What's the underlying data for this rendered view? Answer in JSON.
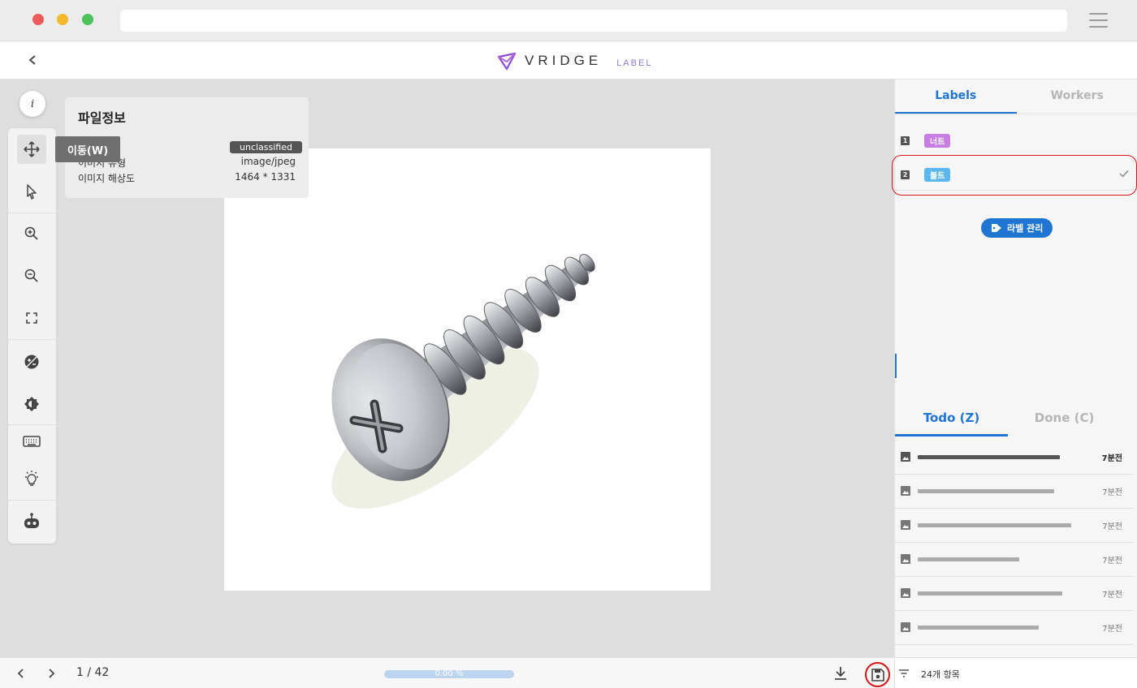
{
  "app": {
    "brand": "VRIDGE",
    "brand_sub": "LABEL",
    "accent": "#1f76d2"
  },
  "file_info": {
    "title": "파일정보",
    "status_badge": "unclassified",
    "rows": [
      {
        "label": "이미지 유형",
        "value": "image/jpeg"
      },
      {
        "label": "이미지 해상도",
        "value": "1464 * 1331"
      }
    ]
  },
  "toolbar": {
    "active_tooltip": "이동(W)",
    "tools": [
      "move-icon",
      "select-pointer-icon",
      "zoom-in-icon",
      "zoom-out-icon",
      "fit-screen-icon",
      "contrast-icon",
      "brightness-icon",
      "keyboard-icon",
      "lightbulb-icon",
      "robot-icon"
    ]
  },
  "bottom_bar": {
    "page_indicator": "1 / 42",
    "progress_label": "0.00 %",
    "progress_value": 0.0
  },
  "right_panel": {
    "tabs": [
      "Labels",
      "Workers"
    ],
    "labels": [
      {
        "num": "1",
        "name": "너트",
        "color": "#c77de3",
        "selected": false
      },
      {
        "num": "2",
        "name": "볼트",
        "color": "#5bb8ee",
        "selected": true
      }
    ],
    "manage_button": "라벨 관리",
    "task_tabs": [
      "Todo (Z)",
      "Done (C)"
    ],
    "files": [
      {
        "time": "7분전",
        "active": true,
        "bar": 175
      },
      {
        "time": "7분전",
        "active": false,
        "bar": 168
      },
      {
        "time": "7분전",
        "active": false,
        "bar": 189
      },
      {
        "time": "7분전",
        "active": false,
        "bar": 125
      },
      {
        "time": "7분전",
        "active": false,
        "bar": 178
      },
      {
        "time": "7분전",
        "active": false,
        "bar": 149
      }
    ],
    "item_count": "24개 항목"
  }
}
